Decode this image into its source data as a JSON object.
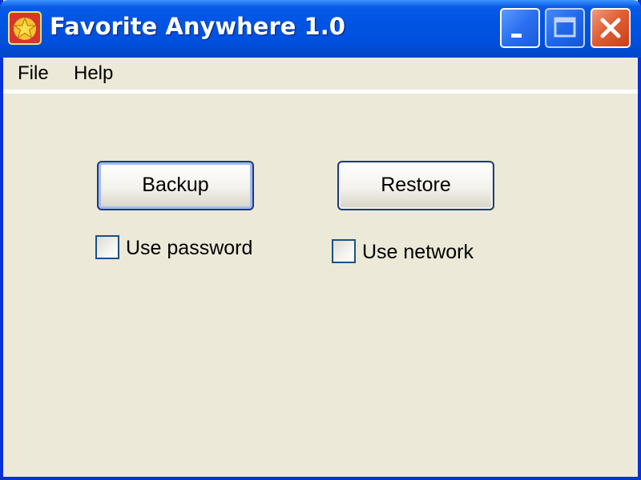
{
  "window": {
    "title": "Favorite Anywhere 1.0",
    "app_icon": "favorite-star-icon",
    "controls": {
      "minimize_icon": "minimize-icon",
      "maximize_icon": "maximize-icon",
      "close_icon": "close-icon"
    }
  },
  "menu": {
    "items": [
      {
        "label": "File"
      },
      {
        "label": "Help"
      }
    ]
  },
  "main": {
    "backup_label": "Backup",
    "restore_label": "Restore",
    "use_password": {
      "label": "Use password",
      "checked": false
    },
    "use_network": {
      "label": "Use network",
      "checked": false
    }
  },
  "colors": {
    "titlebar": "#0054e3",
    "window_bg": "#ece9d8",
    "close_button": "#e15f34"
  }
}
